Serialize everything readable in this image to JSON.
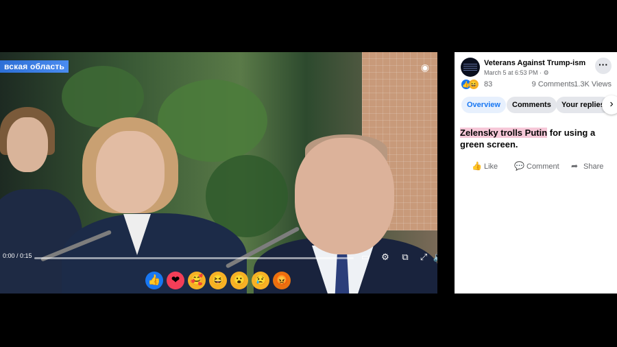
{
  "video": {
    "channel_label": "вская область",
    "time": "0:00 / 0:15",
    "progress_fraction": 0
  },
  "reaction_bar": [
    {
      "name": "like",
      "glyph": "👍",
      "bg": "#1877f2"
    },
    {
      "name": "love",
      "glyph": "❤",
      "bg": "#f33e58"
    },
    {
      "name": "care",
      "glyph": "🥰",
      "bg": "#f7b125"
    },
    {
      "name": "haha",
      "glyph": "😆",
      "bg": "#f7b125"
    },
    {
      "name": "wow",
      "glyph": "😮",
      "bg": "#f7b125"
    },
    {
      "name": "sad",
      "glyph": "😢",
      "bg": "#f7b125"
    },
    {
      "name": "angry",
      "glyph": "😡",
      "bg": "#e9710f"
    }
  ],
  "post": {
    "page_name": "Veterans Against Trump-ism",
    "meta": "March 5 at 6:53 PM ·",
    "reaction_count": "83",
    "comments": "9 Comments",
    "views": "1.3K Views",
    "caption_highlight": "Zelensky trolls Putin",
    "caption_rest": " for using a green screen."
  },
  "tabs": [
    "Overview",
    "Comments",
    "Your replies"
  ],
  "actions": {
    "like": "Like",
    "comment": "Comment",
    "share": "Share"
  },
  "colors": {
    "accent": "#1877f2",
    "highlight": "#f6c8d8"
  }
}
